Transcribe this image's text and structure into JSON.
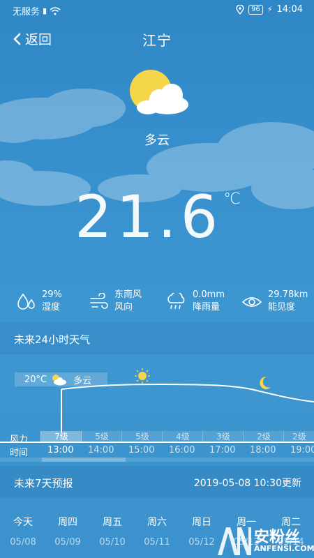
{
  "status": {
    "carrier": "无服务",
    "battery": "96",
    "time": "14:04"
  },
  "header": {
    "back_label": "返回",
    "city": "江宁"
  },
  "current": {
    "condition": "多云",
    "temperature": "21.6",
    "unit": "℃"
  },
  "metrics": [
    {
      "icon": "humidity-icon",
      "value": "29%",
      "label": "湿度"
    },
    {
      "icon": "wind-icon",
      "value": "东南风",
      "label": "风向"
    },
    {
      "icon": "rain-icon",
      "value": "0.0mm",
      "label": "降雨量"
    },
    {
      "icon": "eye-icon",
      "value": "29.78km",
      "label": "能见度"
    }
  ],
  "hourly": {
    "title": "未来24小时天气",
    "tooltip": {
      "temp": "20°C",
      "condition": "多云"
    },
    "wind_label": "风力",
    "time_label": "时间",
    "wind": [
      "7级",
      "5级",
      "5级",
      "4级",
      "3级",
      "2级",
      "2级"
    ],
    "times": [
      "13:00",
      "14:00",
      "15:00",
      "16:00",
      "17:00",
      "18:00",
      "19:00"
    ]
  },
  "forecast": {
    "title": "未来7天预报",
    "updated": "2019-05-08 10:30更新",
    "days": [
      {
        "name": "今天",
        "date": "05/08"
      },
      {
        "name": "周四",
        "date": "05/09"
      },
      {
        "name": "周五",
        "date": "05/10"
      },
      {
        "name": "周六",
        "date": "05/11"
      },
      {
        "name": "周日",
        "date": "05/12"
      },
      {
        "name": "周一",
        "date": "05/13"
      },
      {
        "name": "周二",
        "date": "05/14"
      }
    ]
  },
  "watermark": {
    "brand": "安粉丝",
    "sub": "ANFENSI.COM"
  }
}
